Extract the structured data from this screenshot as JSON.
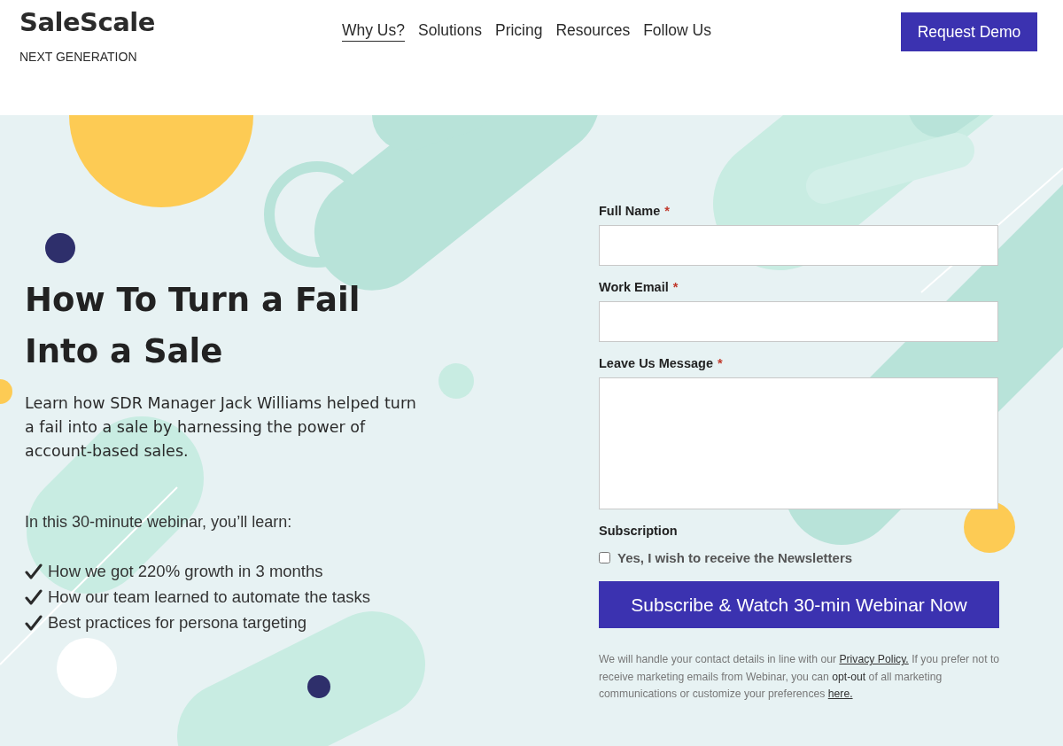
{
  "brand": {
    "name": "SaleScale",
    "tagline": "NEXT GENERATION"
  },
  "nav": [
    {
      "label": "Why Us?",
      "selected": true
    },
    {
      "label": "Solutions",
      "selected": false
    },
    {
      "label": "Pricing",
      "selected": false
    },
    {
      "label": "Resources",
      "selected": false
    },
    {
      "label": "Follow Us",
      "selected": false
    }
  ],
  "cta_button": "Request Demo",
  "hero": {
    "title": "How To Turn a Fail Into a Sale",
    "intro": "Learn how SDR Manager Jack Williams helped turn a fail into a sale by harnessing the power of account-based sales.",
    "lead": "In this 30-minute webinar, you’ll learn:",
    "points": [
      "How we got 220% growth in 3 months",
      "How our team learned to automate the tasks",
      "Best practices for persona targeting"
    ]
  },
  "form": {
    "fields": [
      {
        "label": "Full Name",
        "required_mark": "*",
        "kind": "input"
      },
      {
        "label": "Work Email",
        "required_mark": "*",
        "kind": "input"
      },
      {
        "label": "Leave Us Message",
        "required_mark": "*",
        "kind": "textarea"
      }
    ],
    "subscription": {
      "heading": "Subscription",
      "label": "Yes, I wish to receive the Newsletters",
      "checked": false
    },
    "submit": "Subscribe & Watch 30-min Webinar Now",
    "notice": [
      {
        "kind": "text",
        "text": "We will handle your contact details in line with our "
      },
      {
        "kind": "link",
        "text": "Privacy Policy."
      },
      {
        "kind": "text",
        "text": " If you prefer not to receive marketing emails from Webinar, you can "
      },
      {
        "kind": "emphasis",
        "text": "opt-out"
      },
      {
        "kind": "text",
        "text": " of all marketing communications or customize your preferences "
      },
      {
        "kind": "link",
        "text": "here."
      }
    ]
  }
}
